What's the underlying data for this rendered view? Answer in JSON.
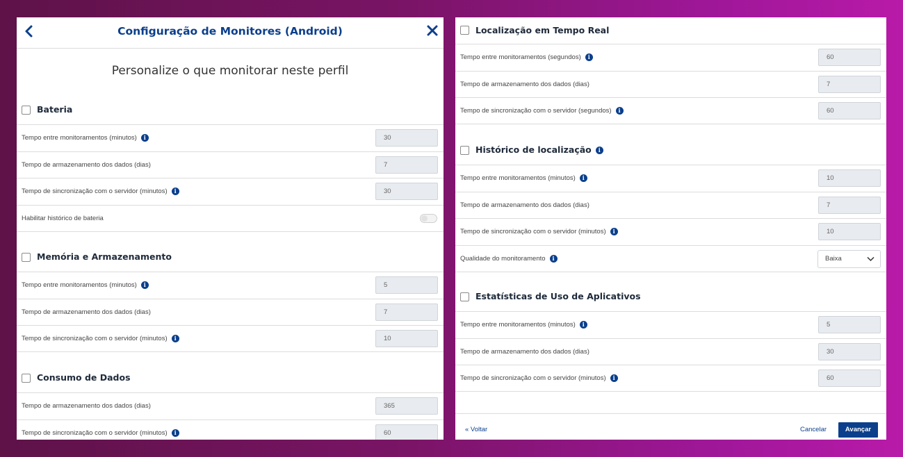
{
  "colors": {
    "accent": "#0b3f8c",
    "background_left": "#5e1248",
    "background_right": "#b81aa8"
  },
  "header": {
    "title": "Configuração de Monitores (Android)"
  },
  "subtitle": "Personalize o que monitorar neste perfil",
  "left_sections": {
    "bateria": {
      "title": "Bateria",
      "rows": [
        {
          "label": "Tempo entre monitoramentos (minutos)",
          "value": "30"
        },
        {
          "label": "Tempo de armazenamento dos dados (dias)",
          "value": "7"
        },
        {
          "label": "Tempo de sincronização com o servidor (minutos)",
          "value": "30"
        }
      ],
      "toggle_label": "Habilitar histórico de bateria"
    },
    "memoria": {
      "title": "Memória e Armazenamento",
      "rows": [
        {
          "label": "Tempo entre monitoramentos (minutos)",
          "value": "5"
        },
        {
          "label": "Tempo de armazenamento dos dados (dias)",
          "value": "7"
        },
        {
          "label": "Tempo de sincronização com o servidor (minutos)",
          "value": "10"
        }
      ]
    },
    "consumo": {
      "title": "Consumo de Dados",
      "rows": [
        {
          "label": "Tempo de armazenamento dos dados (dias)",
          "value": "365"
        },
        {
          "label": "Tempo de sincronização com o servidor (minutos)",
          "value": "60"
        }
      ]
    }
  },
  "right_sections": {
    "tempo_real": {
      "title": "Localização em Tempo Real",
      "rows": [
        {
          "label": "Tempo entre monitoramentos (segundos)",
          "value": "60"
        },
        {
          "label": "Tempo de armazenamento dos dados (dias)",
          "value": "7"
        },
        {
          "label": "Tempo de sincronização com o servidor (segundos)",
          "value": "60"
        }
      ]
    },
    "historico": {
      "title": "Histórico de localização",
      "rows": [
        {
          "label": "Tempo entre monitoramentos (minutos)",
          "value": "10"
        },
        {
          "label": "Tempo de armazenamento dos dados (dias)",
          "value": "7"
        },
        {
          "label": "Tempo de sincronização com o servidor (minutos)",
          "value": "10"
        }
      ],
      "quality_label": "Qualidade do monitoramento",
      "quality_value": "Baixa"
    },
    "estatisticas": {
      "title": "Estatísticas de Uso de Aplicativos",
      "rows": [
        {
          "label": "Tempo entre monitoramentos (minutos)",
          "value": "5"
        },
        {
          "label": "Tempo de armazenamento dos dados (dias)",
          "value": "30"
        },
        {
          "label": "Tempo de sincronização com o servidor (minutos)",
          "value": "60"
        }
      ]
    }
  },
  "footer": {
    "back": "« Voltar",
    "cancel": "Cancelar",
    "next": "Avançar"
  }
}
